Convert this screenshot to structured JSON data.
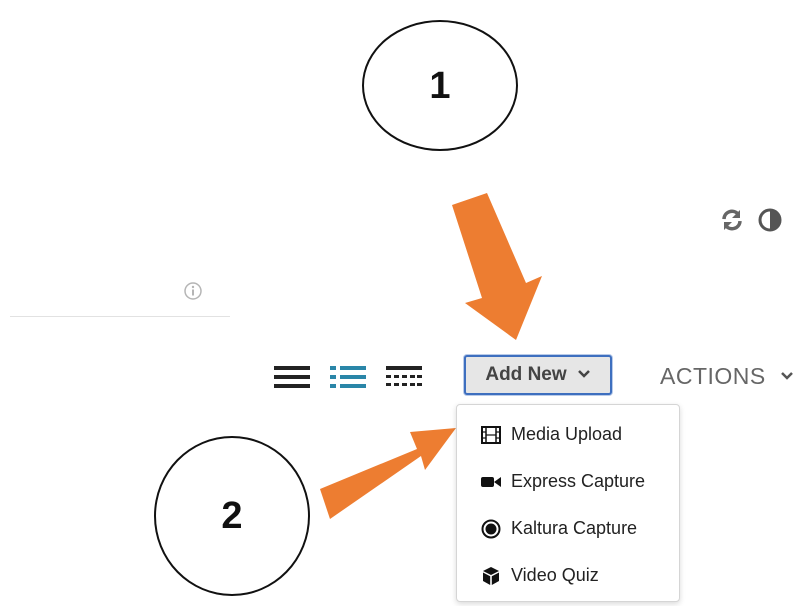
{
  "callouts": [
    {
      "number": "1"
    },
    {
      "number": "2"
    }
  ],
  "toolbar": {
    "refresh_icon": "refresh-icon",
    "contrast_icon": "contrast-icon",
    "info_icon": "info-icon",
    "views": [
      "view-collapsed-icon",
      "view-detailed-icon",
      "view-grid-icon"
    ],
    "add_new_label": "Add New",
    "actions_label": "ACTIONS"
  },
  "menu": {
    "items": [
      {
        "label": "Media Upload",
        "icon": "film-icon"
      },
      {
        "label": "Express Capture",
        "icon": "video-camera-icon"
      },
      {
        "label": "Kaltura Capture",
        "icon": "record-icon"
      },
      {
        "label": "Video Quiz",
        "icon": "cube-icon"
      }
    ]
  },
  "colors": {
    "arrow": "#ed7d31",
    "accent": "#2a86a8",
    "button_border": "#3e6fbf"
  }
}
